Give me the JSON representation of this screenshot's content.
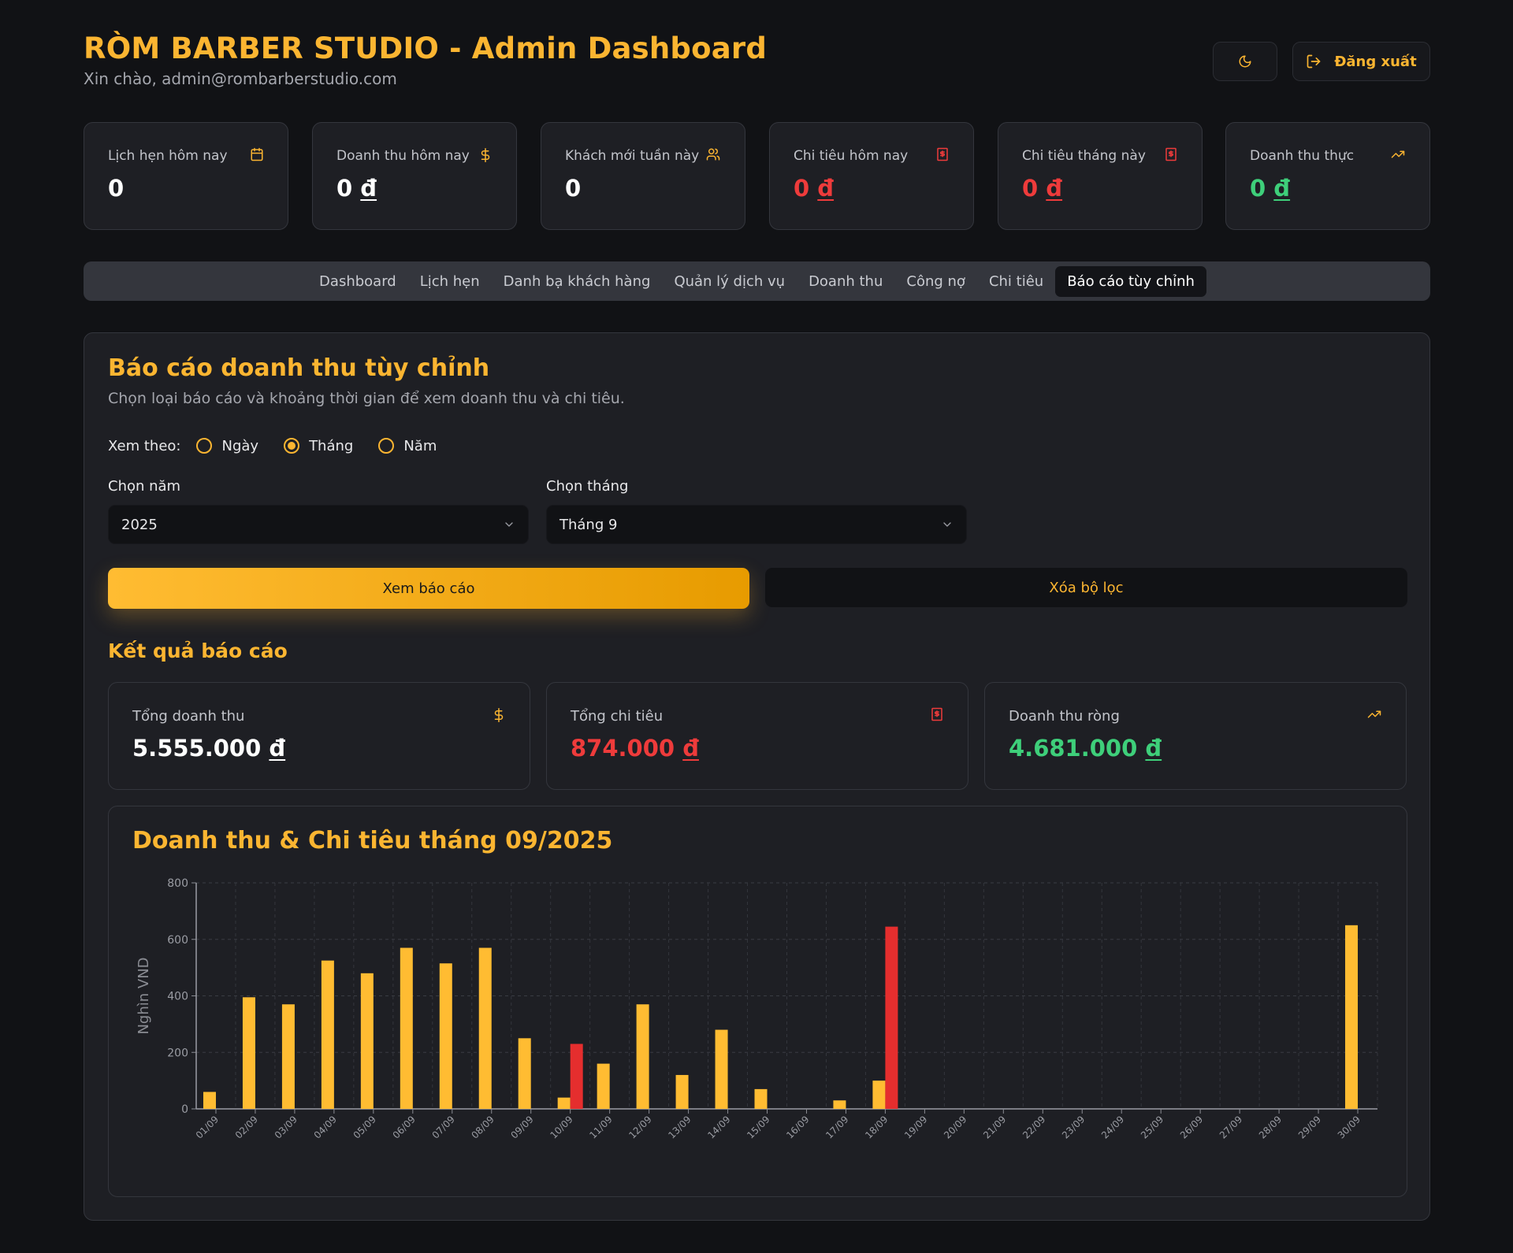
{
  "header": {
    "title": "RÒM BARBER STUDIO - Admin Dashboard",
    "greeting": "Xin chào, admin@rombarberstudio.com",
    "logout_label": "Đăng xuất"
  },
  "stats": [
    {
      "label": "Lịch hẹn hôm nay",
      "value": "0",
      "currency": "",
      "icon": "calendar-icon",
      "color": "#ffffff"
    },
    {
      "label": "Doanh thu hôm nay",
      "value": "0",
      "currency": "đ",
      "icon": "dollar-icon",
      "color": "#ffffff"
    },
    {
      "label": "Khách mới tuần này",
      "value": "0",
      "currency": "",
      "icon": "users-icon",
      "color": "#ffffff"
    },
    {
      "label": "Chi tiêu hôm nay",
      "value": "0",
      "currency": "đ",
      "icon": "receipt-icon",
      "color": "#ee3b3b"
    },
    {
      "label": "Chi tiêu tháng này",
      "value": "0",
      "currency": "đ",
      "icon": "receipt-icon",
      "color": "#ee3b3b"
    },
    {
      "label": "Doanh thu thực",
      "value": "0",
      "currency": "đ",
      "icon": "trending-up-icon",
      "color": "#3ecf7a"
    }
  ],
  "tabs": [
    {
      "label": "Dashboard",
      "active": false
    },
    {
      "label": "Lịch hẹn",
      "active": false
    },
    {
      "label": "Danh bạ khách hàng",
      "active": false
    },
    {
      "label": "Quản lý dịch vụ",
      "active": false
    },
    {
      "label": "Doanh thu",
      "active": false
    },
    {
      "label": "Công nợ",
      "active": false
    },
    {
      "label": "Chi tiêu",
      "active": false
    },
    {
      "label": "Báo cáo tùy chỉnh",
      "active": true
    }
  ],
  "report": {
    "title": "Báo cáo doanh thu tùy chỉnh",
    "subtitle": "Chọn loại báo cáo và khoảng thời gian để xem doanh thu và chi tiêu.",
    "view_by_label": "Xem theo:",
    "view_options": [
      {
        "label": "Ngày",
        "checked": false
      },
      {
        "label": "Tháng",
        "checked": true
      },
      {
        "label": "Năm",
        "checked": false
      }
    ],
    "year_label": "Chọn năm",
    "year_value": "2025",
    "month_label": "Chọn tháng",
    "month_value": "Tháng 9",
    "view_button": "Xem báo cáo",
    "clear_button": "Xóa bộ lọc",
    "results_title": "Kết quả báo cáo",
    "results": [
      {
        "label": "Tổng doanh thu",
        "value": "5.555.000",
        "currency": "đ",
        "icon": "dollar-icon",
        "color": "#ffffff"
      },
      {
        "label": "Tổng chi tiêu",
        "value": "874.000",
        "currency": "đ",
        "icon": "receipt-icon",
        "color": "#ee3b3b"
      },
      {
        "label": "Doanh thu ròng",
        "value": "4.681.000",
        "currency": "đ",
        "icon": "trending-up-icon",
        "color": "#3ecf7a"
      }
    ]
  },
  "colors": {
    "accent": "#fbb531",
    "expense": "#ee3b3b",
    "profit": "#3ecf7a",
    "background": "#111215",
    "card": "#1e1f24"
  },
  "chart_data": {
    "type": "bar",
    "title": "Doanh thu & Chi tiêu tháng 09/2025",
    "ylabel": "Nghìn VND",
    "xlabel": "",
    "ylim": [
      0,
      800
    ],
    "yticks": [
      0,
      200,
      400,
      600,
      800
    ],
    "grid": true,
    "categories": [
      "01/09",
      "02/09",
      "03/09",
      "04/09",
      "05/09",
      "06/09",
      "07/09",
      "08/09",
      "09/09",
      "10/09",
      "11/09",
      "12/09",
      "13/09",
      "14/09",
      "15/09",
      "16/09",
      "17/09",
      "18/09",
      "19/09",
      "20/09",
      "21/09",
      "22/09",
      "23/09",
      "24/09",
      "25/09",
      "26/09",
      "27/09",
      "28/09",
      "29/09",
      "30/09"
    ],
    "series": [
      {
        "color": "#ffbc32",
        "values": [
          60,
          395,
          370,
          525,
          480,
          570,
          515,
          570,
          250,
          40,
          160,
          370,
          120,
          280,
          70,
          0,
          30,
          100,
          0,
          0,
          0,
          0,
          0,
          0,
          0,
          0,
          0,
          0,
          0,
          650
        ]
      },
      {
        "color": "#e52e2e",
        "values": [
          0,
          0,
          0,
          0,
          0,
          0,
          0,
          0,
          0,
          230,
          0,
          0,
          0,
          0,
          0,
          0,
          0,
          645,
          0,
          0,
          0,
          0,
          0,
          0,
          0,
          0,
          0,
          0,
          0,
          0
        ]
      }
    ]
  }
}
